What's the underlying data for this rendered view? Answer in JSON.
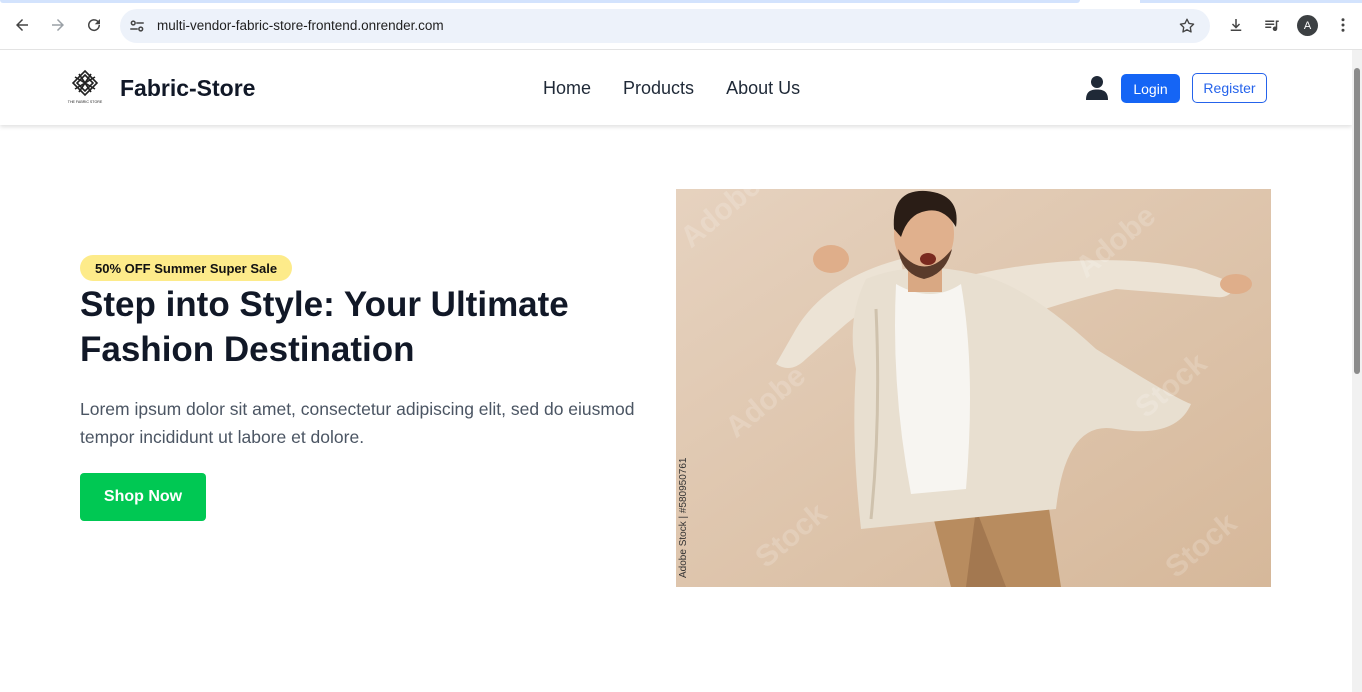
{
  "browser": {
    "url": "multi-vendor-fabric-store-frontend.onrender.com",
    "profile_initial": "A"
  },
  "header": {
    "brand": "Fabric-Store",
    "logo_caption": "THE FABRIC STORE",
    "menu": [
      {
        "label": "Home"
      },
      {
        "label": "Products"
      },
      {
        "label": "About Us"
      }
    ],
    "login_label": "Login",
    "register_label": "Register"
  },
  "hero": {
    "badge": "50% OFF Summer Super Sale",
    "title": "Step into Style: Your Ultimate Fashion Destination",
    "description": "Lorem ipsum dolor sit amet, consectetur adipiscing elit, sed do eiusmod tempor incididunt ut labore et dolore.",
    "cta_label": "Shop Now",
    "image_credit": "Adobe Stock | #580950761"
  },
  "colors": {
    "primary_blue": "#1565f5",
    "cta_green": "#00c853",
    "badge_yellow": "#fdeb8a",
    "image_bg": "#dfc7ae"
  }
}
